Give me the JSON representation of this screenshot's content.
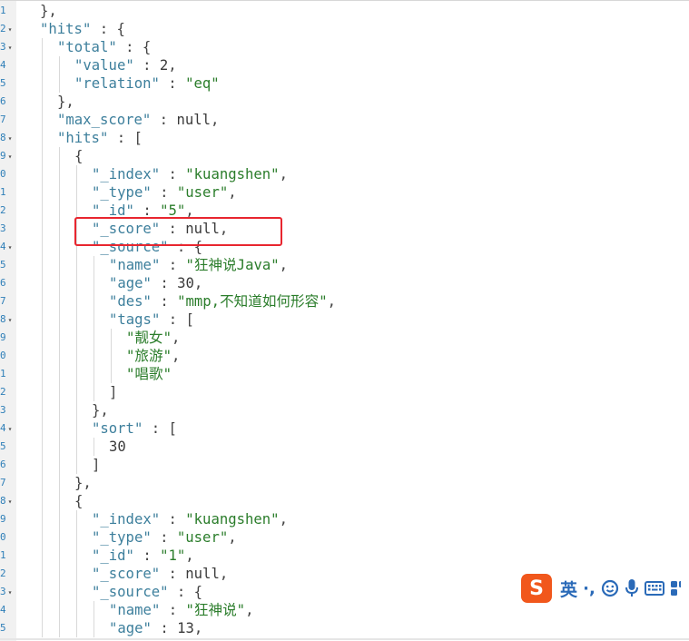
{
  "gutter": {
    "digits": [
      "1",
      "2",
      "3",
      "4",
      "5",
      "6",
      "7",
      "8",
      "9",
      "0",
      "1",
      "2",
      "3",
      "4",
      "5",
      "6",
      "7",
      "8",
      "9",
      "0",
      "1",
      "2",
      "3",
      "4",
      "5",
      "6",
      "7",
      "8",
      "9",
      "0",
      "1",
      "2",
      "3",
      "4",
      "5"
    ]
  },
  "code": {
    "lines": [
      {
        "indent": 2,
        "tokens": [
          {
            "t": "},",
            "c": "punc"
          }
        ]
      },
      {
        "indent": 2,
        "tokens": [
          {
            "t": "\"hits\"",
            "c": "key"
          },
          {
            "t": " : {",
            "c": "punc"
          }
        ]
      },
      {
        "indent": 3,
        "tokens": [
          {
            "t": "\"total\"",
            "c": "key"
          },
          {
            "t": " : {",
            "c": "punc"
          }
        ]
      },
      {
        "indent": 4,
        "tokens": [
          {
            "t": "\"value\"",
            "c": "key"
          },
          {
            "t": " : ",
            "c": "punc"
          },
          {
            "t": "2",
            "c": "num"
          },
          {
            "t": ",",
            "c": "punc"
          }
        ]
      },
      {
        "indent": 4,
        "tokens": [
          {
            "t": "\"relation\"",
            "c": "key"
          },
          {
            "t": " : ",
            "c": "punc"
          },
          {
            "t": "\"eq\"",
            "c": "str"
          }
        ]
      },
      {
        "indent": 3,
        "tokens": [
          {
            "t": "},",
            "c": "punc"
          }
        ]
      },
      {
        "indent": 3,
        "tokens": [
          {
            "t": "\"max_score\"",
            "c": "key"
          },
          {
            "t": " : ",
            "c": "punc"
          },
          {
            "t": "null",
            "c": "nul"
          },
          {
            "t": ",",
            "c": "punc"
          }
        ]
      },
      {
        "indent": 3,
        "tokens": [
          {
            "t": "\"hits\"",
            "c": "key"
          },
          {
            "t": " : [",
            "c": "punc"
          }
        ]
      },
      {
        "indent": 4,
        "tokens": [
          {
            "t": "{",
            "c": "punc"
          }
        ]
      },
      {
        "indent": 5,
        "tokens": [
          {
            "t": "\"_index\"",
            "c": "key"
          },
          {
            "t": " : ",
            "c": "punc"
          },
          {
            "t": "\"kuangshen\"",
            "c": "str"
          },
          {
            "t": ",",
            "c": "punc"
          }
        ]
      },
      {
        "indent": 5,
        "tokens": [
          {
            "t": "\"_type\"",
            "c": "key"
          },
          {
            "t": " : ",
            "c": "punc"
          },
          {
            "t": "\"user\"",
            "c": "str"
          },
          {
            "t": ",",
            "c": "punc"
          }
        ]
      },
      {
        "indent": 5,
        "tokens": [
          {
            "t": "\"_id\"",
            "c": "key"
          },
          {
            "t": " : ",
            "c": "punc"
          },
          {
            "t": "\"5\"",
            "c": "str"
          },
          {
            "t": ",",
            "c": "punc"
          }
        ]
      },
      {
        "indent": 5,
        "tokens": [
          {
            "t": "\"_score\"",
            "c": "key"
          },
          {
            "t": " : ",
            "c": "punc"
          },
          {
            "t": "null",
            "c": "nul"
          },
          {
            "t": ",",
            "c": "punc"
          }
        ]
      },
      {
        "indent": 5,
        "tokens": [
          {
            "t": "\"_source\"",
            "c": "key"
          },
          {
            "t": " : {",
            "c": "punc"
          }
        ]
      },
      {
        "indent": 6,
        "tokens": [
          {
            "t": "\"name\"",
            "c": "key"
          },
          {
            "t": " : ",
            "c": "punc"
          },
          {
            "t": "\"狂神说Java\"",
            "c": "str"
          },
          {
            "t": ",",
            "c": "punc"
          }
        ]
      },
      {
        "indent": 6,
        "tokens": [
          {
            "t": "\"age\"",
            "c": "key"
          },
          {
            "t": " : ",
            "c": "punc"
          },
          {
            "t": "30",
            "c": "num"
          },
          {
            "t": ",",
            "c": "punc"
          }
        ]
      },
      {
        "indent": 6,
        "tokens": [
          {
            "t": "\"des\"",
            "c": "key"
          },
          {
            "t": " : ",
            "c": "punc"
          },
          {
            "t": "\"mmp,不知道如何形容\"",
            "c": "str"
          },
          {
            "t": ",",
            "c": "punc"
          }
        ]
      },
      {
        "indent": 6,
        "tokens": [
          {
            "t": "\"tags\"",
            "c": "key"
          },
          {
            "t": " : [",
            "c": "punc"
          }
        ]
      },
      {
        "indent": 7,
        "tokens": [
          {
            "t": "\"靓女\"",
            "c": "str"
          },
          {
            "t": ",",
            "c": "punc"
          }
        ]
      },
      {
        "indent": 7,
        "tokens": [
          {
            "t": "\"旅游\"",
            "c": "str"
          },
          {
            "t": ",",
            "c": "punc"
          }
        ]
      },
      {
        "indent": 7,
        "tokens": [
          {
            "t": "\"唱歌\"",
            "c": "str"
          }
        ]
      },
      {
        "indent": 6,
        "tokens": [
          {
            "t": "]",
            "c": "punc"
          }
        ]
      },
      {
        "indent": 5,
        "tokens": [
          {
            "t": "},",
            "c": "punc"
          }
        ]
      },
      {
        "indent": 5,
        "tokens": [
          {
            "t": "\"sort\"",
            "c": "key"
          },
          {
            "t": " : [",
            "c": "punc"
          }
        ]
      },
      {
        "indent": 6,
        "tokens": [
          {
            "t": "30",
            "c": "num"
          }
        ]
      },
      {
        "indent": 5,
        "tokens": [
          {
            "t": "]",
            "c": "punc"
          }
        ]
      },
      {
        "indent": 4,
        "tokens": [
          {
            "t": "},",
            "c": "punc"
          }
        ]
      },
      {
        "indent": 4,
        "tokens": [
          {
            "t": "{",
            "c": "punc"
          }
        ]
      },
      {
        "indent": 5,
        "tokens": [
          {
            "t": "\"_index\"",
            "c": "key"
          },
          {
            "t": " : ",
            "c": "punc"
          },
          {
            "t": "\"kuangshen\"",
            "c": "str"
          },
          {
            "t": ",",
            "c": "punc"
          }
        ]
      },
      {
        "indent": 5,
        "tokens": [
          {
            "t": "\"_type\"",
            "c": "key"
          },
          {
            "t": " : ",
            "c": "punc"
          },
          {
            "t": "\"user\"",
            "c": "str"
          },
          {
            "t": ",",
            "c": "punc"
          }
        ]
      },
      {
        "indent": 5,
        "tokens": [
          {
            "t": "\"_id\"",
            "c": "key"
          },
          {
            "t": " : ",
            "c": "punc"
          },
          {
            "t": "\"1\"",
            "c": "str"
          },
          {
            "t": ",",
            "c": "punc"
          }
        ]
      },
      {
        "indent": 5,
        "tokens": [
          {
            "t": "\"_score\"",
            "c": "key"
          },
          {
            "t": " : ",
            "c": "punc"
          },
          {
            "t": "null",
            "c": "nul"
          },
          {
            "t": ",",
            "c": "punc"
          }
        ]
      },
      {
        "indent": 5,
        "tokens": [
          {
            "t": "\"_source\"",
            "c": "key"
          },
          {
            "t": " : {",
            "c": "punc"
          }
        ]
      },
      {
        "indent": 6,
        "tokens": [
          {
            "t": "\"name\"",
            "c": "key"
          },
          {
            "t": " : ",
            "c": "punc"
          },
          {
            "t": "\"狂神说\"",
            "c": "str"
          },
          {
            "t": ",",
            "c": "punc"
          }
        ]
      },
      {
        "indent": 6,
        "tokens": [
          {
            "t": "\"age\"",
            "c": "key"
          },
          {
            "t": " : ",
            "c": "punc"
          },
          {
            "t": "13",
            "c": "num"
          },
          {
            "t": ",",
            "c": "punc"
          }
        ]
      }
    ],
    "fold_markers": [
      "",
      "open",
      "open",
      "",
      "",
      "",
      "",
      "open",
      "open",
      "",
      "",
      "",
      "",
      "open",
      "",
      "",
      "",
      "open",
      "",
      "",
      "",
      "",
      "",
      "open",
      "",
      "",
      "",
      "open",
      "",
      "",
      "",
      "",
      "open",
      "",
      ""
    ]
  },
  "ime": {
    "logo_letter": "S",
    "mode_label": "英",
    "punct_label": "·,",
    "icons": [
      "emoji-icon",
      "microphone-icon",
      "keyboard-icon",
      "more-icon"
    ]
  },
  "colors": {
    "key": "#3d7f9c",
    "string": "#2b7d2b",
    "highlight_border": "#e8262f",
    "ime_brand": "#f1571c",
    "ime_icons": "#2a6ab8"
  }
}
